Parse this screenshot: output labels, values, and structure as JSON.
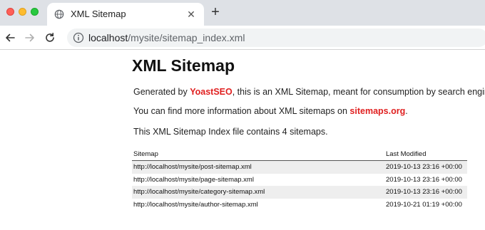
{
  "browser": {
    "tab_title": "XML Sitemap",
    "new_tab_symbol": "+",
    "close_symbol": "✕",
    "url_host": "localhost",
    "url_path": "/mysite/sitemap_index.xml"
  },
  "page": {
    "title": "XML Sitemap",
    "generated_prefix": "Generated by ",
    "generated_link": "YoastSEO",
    "generated_suffix": ", this is an XML Sitemap, meant for consumption by search engines.",
    "info_prefix": "You can find more information about XML sitemaps on ",
    "info_link": "sitemaps.org",
    "info_suffix": ".",
    "count_text": "This XML Sitemap Index file contains 4 sitemaps."
  },
  "table": {
    "headers": [
      "Sitemap",
      "Last Modified"
    ],
    "rows": [
      {
        "loc": "http://localhost/mysite/post-sitemap.xml",
        "lastmod": "2019-10-13 23:16 +00:00"
      },
      {
        "loc": "http://localhost/mysite/page-sitemap.xml",
        "lastmod": "2019-10-13 23:16 +00:00"
      },
      {
        "loc": "http://localhost/mysite/category-sitemap.xml",
        "lastmod": "2019-10-13 23:16 +00:00"
      },
      {
        "loc": "http://localhost/mysite/author-sitemap.xml",
        "lastmod": "2019-10-21 01:19 +00:00"
      }
    ]
  },
  "colors": {
    "link": "#e02020",
    "row_shade": "#eeeeee",
    "tabbar": "#dee1e6"
  }
}
